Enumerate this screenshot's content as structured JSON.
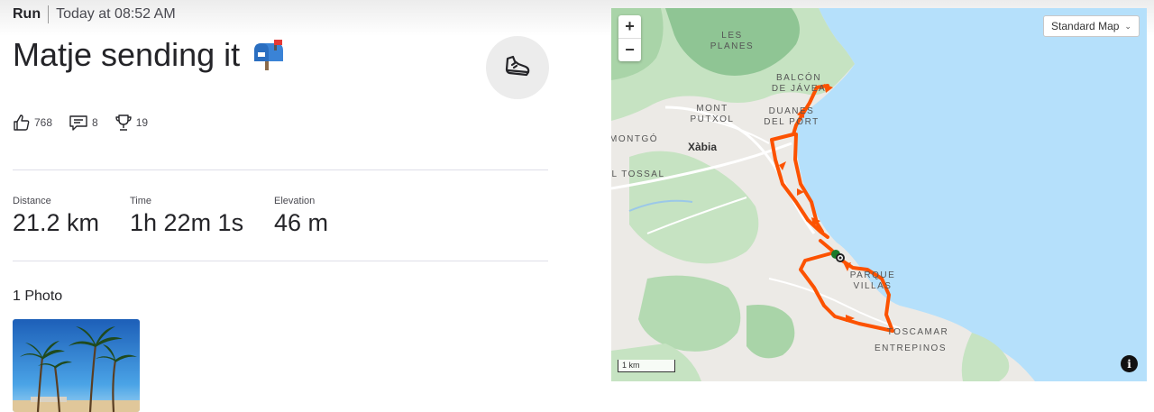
{
  "activity": {
    "type": "Run",
    "time": "Today at 08:52 AM",
    "title": "Matje sending it",
    "sport_icon": "running-shoe-icon"
  },
  "social": {
    "kudos": "768",
    "comments": "8",
    "achievements": "19"
  },
  "stats": [
    {
      "label": "Distance",
      "value": "21.2 km"
    },
    {
      "label": "Time",
      "value": "1h 22m 1s"
    },
    {
      "label": "Elevation",
      "value": "46 m"
    }
  ],
  "photos": {
    "label": "1 Photo"
  },
  "map": {
    "style_label": "Standard Map",
    "zoom_in": "+",
    "zoom_out": "−",
    "scale": "1 km",
    "info": "i",
    "labels": {
      "les_planes_1": "LES",
      "les_planes_2": "PLANES",
      "balcon_1": "BALCÓN",
      "balcon_2": "DE JÁVEA",
      "mont_1": "MONT",
      "mont_2": "PUTXOL",
      "duanes_1": "DUANES",
      "duanes_2": "DEL PORT",
      "montgo": "MONTGÓ",
      "xabia": "Xàbia",
      "tossal": "L TOSSAL",
      "parque_1": "PARQUE",
      "parque_2": "VILLAS",
      "toscamar": "TOSCAMAR",
      "entrepinos": "ENTREPINOS"
    },
    "colors": {
      "route": "#fc5200",
      "sea": "#b5e0fb",
      "land": "#eceae6",
      "green": "#c6e3c2",
      "mountain": "#8fc594"
    }
  }
}
